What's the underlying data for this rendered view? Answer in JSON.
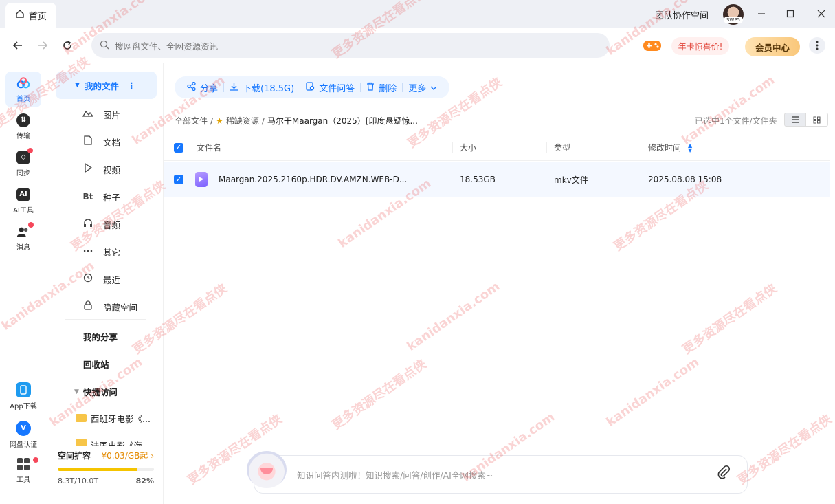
{
  "titlebar": {
    "home_tab": "首页",
    "team_space": "团队协作空间",
    "avatar_tag": "SWP5"
  },
  "navbar": {
    "search_placeholder": "搜网盘文件、全网资源资讯",
    "promo": "年卡惊喜价!",
    "vip": "会员中心"
  },
  "rail": {
    "items": [
      {
        "label": "首页",
        "icon": "cloud-icon",
        "color": "#1677ff"
      },
      {
        "label": "传输",
        "icon": "transfer-icon",
        "color": "#333333"
      },
      {
        "label": "同步",
        "icon": "sync-icon",
        "color": "#333333"
      },
      {
        "label": "AI工具",
        "icon": "ai-tools-icon",
        "color": "#333333"
      },
      {
        "label": "消息",
        "icon": "message-icon",
        "color": "#333333"
      },
      {
        "label": "App下载",
        "icon": "app-download-icon",
        "color": "#1e9bf0"
      },
      {
        "label": "网盘认证",
        "icon": "verify-icon",
        "color": "#1677ff"
      },
      {
        "label": "工具",
        "icon": "tools-icon",
        "color": "#333333"
      }
    ]
  },
  "sidebar": {
    "my_files": "我的文件",
    "categories": [
      {
        "label": "图片",
        "icon": "image-icon"
      },
      {
        "label": "文档",
        "icon": "document-icon"
      },
      {
        "label": "视频",
        "icon": "video-icon"
      },
      {
        "label": "种子",
        "icon": "torrent-icon",
        "glyph": "Bt"
      },
      {
        "label": "音频",
        "icon": "audio-icon"
      },
      {
        "label": "其它",
        "icon": "other-icon"
      },
      {
        "label": "最近",
        "icon": "recent-icon"
      },
      {
        "label": "隐藏空间",
        "icon": "lock-icon"
      }
    ],
    "my_share": "我的分享",
    "recycle": "回收站",
    "quick_access": "快捷访问",
    "quick_items": [
      "西班牙电影《...",
      "法国电影《海"
    ],
    "storage": {
      "label": "空间扩容",
      "price": "¥0.03/GB起",
      "used": "8.3T/10.0T",
      "percent_label": "82%",
      "fill": 0.82
    }
  },
  "toolbar": {
    "share": "分享",
    "download": "下载(18.5G)",
    "file_qa": "文件问答",
    "delete": "删除",
    "more": "更多"
  },
  "breadcrumb": {
    "root": "全部文件",
    "folder": "稀缺资源",
    "current": "马尔干Maargan（2025）[印度悬疑惊..."
  },
  "selection_info": "已选中1个文件/文件夹",
  "table": {
    "headers": {
      "name": "文件名",
      "size": "大小",
      "type": "类型",
      "modified": "修改时间"
    },
    "rows": [
      {
        "name": "Maargan.2025.2160p.HDR.DV.AMZN.WEB-D...",
        "size": "18.53GB",
        "type": "mkv文件",
        "modified": "2025.08.08 15:08"
      }
    ]
  },
  "ai_bar": {
    "placeholder": "知识问答内测啦！知识搜索/问答/创作/AI全网搜索~"
  },
  "watermark": {
    "line1": "kanidanxia.com",
    "line2": "更多资源尽在看点侠"
  }
}
